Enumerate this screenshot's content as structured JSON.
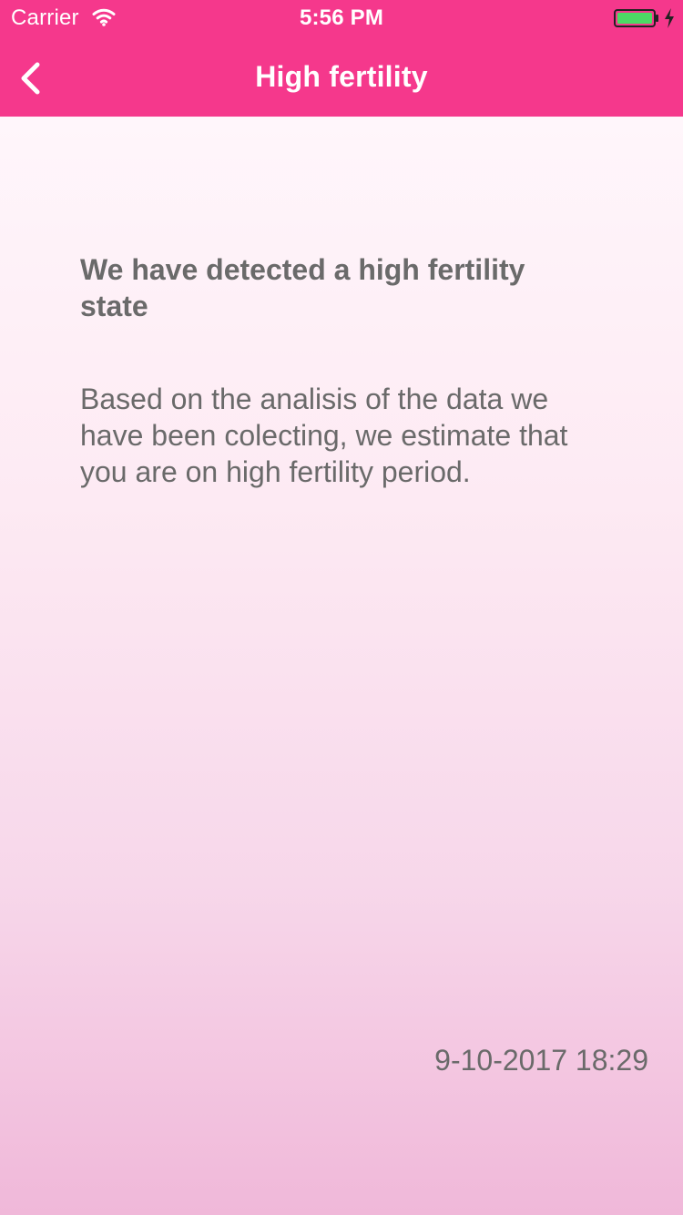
{
  "status_bar": {
    "carrier": "Carrier",
    "time": "5:56 PM",
    "wifi_icon": "wifi-icon",
    "battery_icon": "battery-icon",
    "charging_icon": "bolt-icon"
  },
  "navigation": {
    "title": "High fertility",
    "back_icon": "chevron-left-icon"
  },
  "notification": {
    "headline": "We have detected a high fertility state",
    "body": "Based on the analisis of the data we have been colecting, we estimate that you are on high fertility period.",
    "timestamp": "9-10-2017 18:29"
  },
  "colors": {
    "brand_pink": "#f5388c",
    "text_gray": "#6a6a6a",
    "battery_green": "#4cd964",
    "background_top": "#fff6fb",
    "background_bottom": "#f0b8d9"
  }
}
